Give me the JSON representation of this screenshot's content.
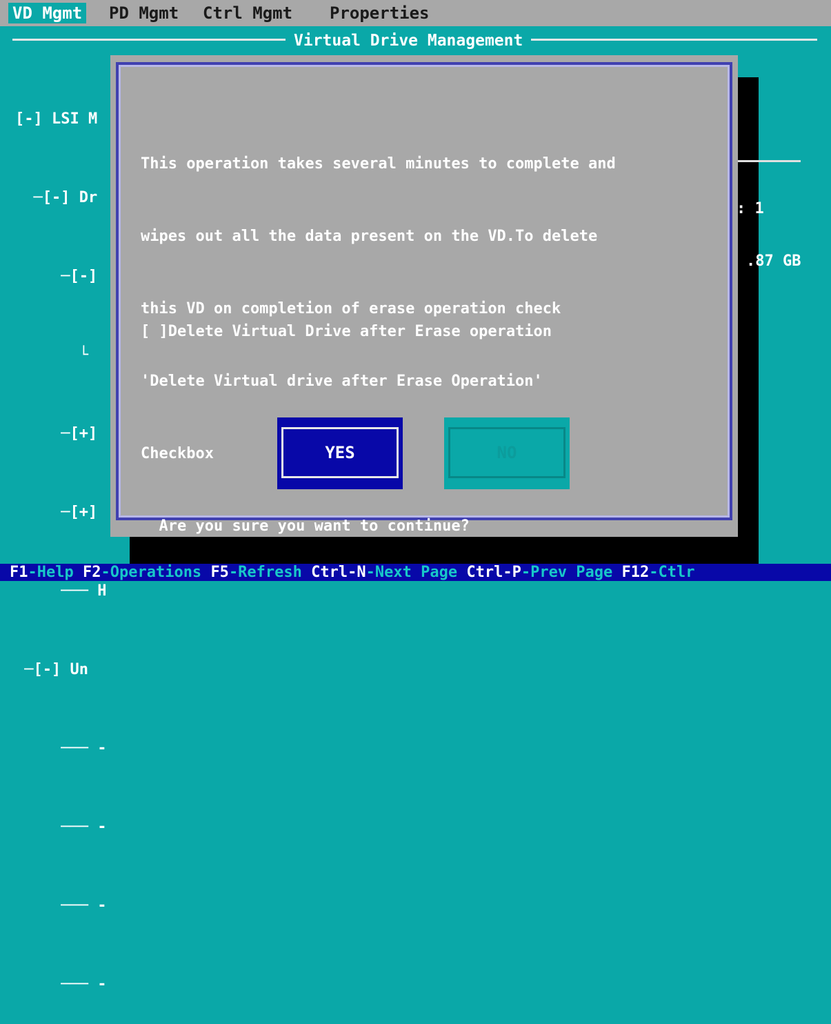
{
  "menu": {
    "items": [
      {
        "label": "VD Mgmt",
        "active": true
      },
      {
        "label": "PD Mgmt",
        "active": false
      },
      {
        "label": "Ctrl Mgmt",
        "active": false
      },
      {
        "label": "Properties",
        "active": false
      }
    ]
  },
  "panel": {
    "title": "Virtual Drive Management"
  },
  "tree": {
    "lines": [
      "[-] LSI M",
      "  ─[-] Dr",
      "     ─[-]",
      "       └",
      "     ─[+]",
      "     ─[+]",
      "     ─── H",
      " ─[-] Un",
      "     ─── -",
      "     ─── -",
      "     ─── -",
      "     ─── -"
    ]
  },
  "background_values": {
    "count": ": 1",
    "size": ".87 GB"
  },
  "dialog": {
    "message_lines": [
      "This operation takes several minutes to complete and",
      "wipes out all the data present on the VD.To delete",
      "this VD on completion of erase operation check",
      "'Delete Virtual drive after Erase Operation'",
      "Checkbox",
      "  Are you sure you want to continue?"
    ],
    "checkbox": {
      "mark": "[ ]",
      "label": "Delete Virtual Drive after Erase operation",
      "checked": false
    },
    "yes_label": "YES",
    "no_label": "NO"
  },
  "statusbar": {
    "items": [
      {
        "key": "F1",
        "desc": "-Help "
      },
      {
        "key": "F2",
        "desc": "-Operations "
      },
      {
        "key": "F5",
        "desc": "-Refresh "
      },
      {
        "key": "Ctrl-N",
        "desc": "-Next Page "
      },
      {
        "key": "Ctrl-P",
        "desc": "-Prev Page "
      },
      {
        "key": "F12",
        "desc": "-Ctlr"
      }
    ]
  },
  "colors": {
    "screen_bg": "#0aa8a8",
    "dialog_bg": "#a8a8a8",
    "button_focus": "#0808a8",
    "statusbar_bg": "#0808a8"
  }
}
